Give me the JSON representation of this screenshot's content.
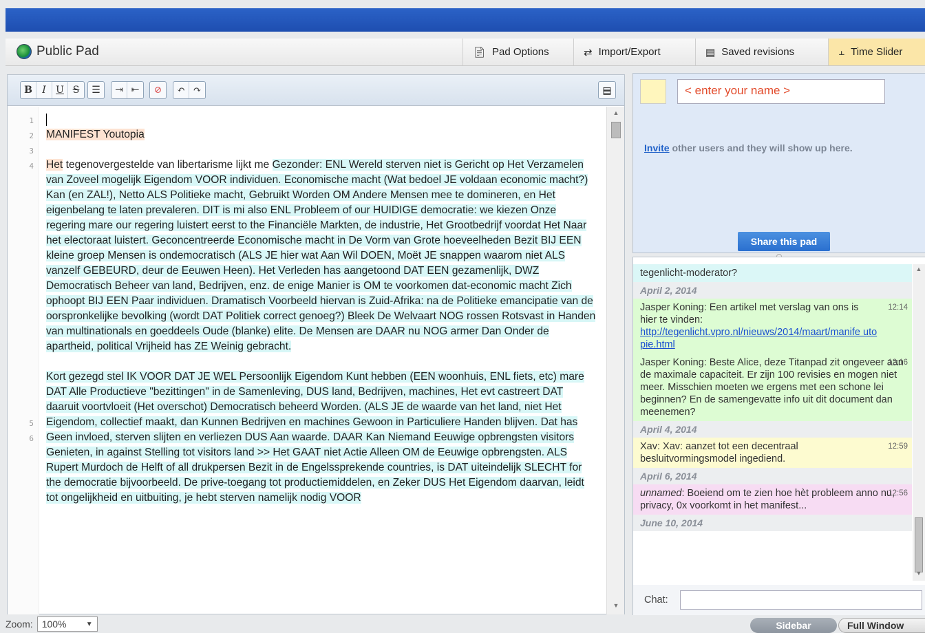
{
  "header": {
    "pad_title": "Public Pad",
    "buttons": {
      "pad_options": "Pad Options",
      "import_export": "Import/Export",
      "saved_revisions": "Saved revisions",
      "time_slider": "Time Slider"
    }
  },
  "toolbar": {
    "bold": "B",
    "italic": "I",
    "underline": "U",
    "strike": "S"
  },
  "editor": {
    "line_numbers": [
      "1",
      "2",
      "3",
      "4",
      "5",
      "6"
    ],
    "line2": [
      "MANIFEST ",
      "Youtopia"
    ],
    "para4_part1": "Het",
    "para4_part2": " tegenovergestelde van libertarisme lijkt me ",
    "para4_part3": "Gezonder: ENL Wereld sterven niet is Gericht op Het Verzamelen van Zoveel mogelijk Eigendom VOOR individuen. Economische macht (Wat bedoel JE voldaan economic macht?) Kan (en ZAL!), Netto ALS Politieke macht, Gebruikt Worden OM Andere Mensen mee te domineren, en Het eigenbelang te laten prevaleren. DIT is mi also ENL Probleem of our HUIDIGE democratie: we kiezen Onze regering mare our regering luistert eerst to the Financiële Markten, de industrie, Het Grootbedrijf voordat Het Naar het electoraat luistert. Geconcentreerde Economische macht in De Vorm van Grote hoeveelheden Bezit BIJ EEN kleine groep Mensen is ondemocratisch (ALS JE hier wat Aan Wil DOEN, Moët JE snappen waarom niet ALS vanzelf GEBEURD, deur de Eeuwen Heen). Het Verleden has aangetoond DAT EEN gezamenlijk, DWZ Democratisch Beheer van land, Bedrijven, enz. de enige Manier is OM te voorkomen dat-economic macht Zich ophoopt BIJ EEN Paar individuen. Dramatisch Voorbeeld hiervan is Zuid-Afrika: na de Politieke emancipatie van de oorspronkelijke bevolking (wordt DAT Politiek correct genoeg?) Bleek De Welvaart NOG rossen Rotsvast in Handen van multinationals en goeddeels Oude (blanke) elite. De Mensen are DAAR nu NOG armer Dan Onder de apartheid, political Vrijheid has ZE Weinig gebracht.",
    "para6": "Kort gezegd stel IK VOOR DAT JE WEL Persoonlijk Eigendom Kunt hebben (EEN woonhuis, ENL fiets, etc) mare DAT Alle Productieve \"bezittingen\" in de Samenleving, DUS land, Bedrijven, machines, Het evt castreert DAT daaruit voortvloeit (Het overschot) Democratisch beheerd Worden. (ALS JE de waarde van het land, niet Het Eigendom, collectief maakt, dan Kunnen Bedrijven en machines Gewoon in Particuliere Handen blijven. Dat has Geen invloed, sterven slijten en verliezen DUS Aan waarde. DAAR Kan Niemand Eeuwige opbrengsten visitors Genieten, in against Stelling tot visitors land >> Het GAAT niet Actie Alleen OM de Eeuwige opbrengsten. ALS Rupert Murdoch de Helft of all drukpersen Bezit in de Engelssprekende countries, is DAT uiteindelijk SLECHT for the democratie bijvoorbeeld. De prive-toegang tot productiemiddelen, en Zeker DUS Het Eigendom daarvan, leidt tot ongelijkheid en uitbuiting, je hebt sterven namelijk nodig VOOR"
  },
  "zoom": {
    "label": "Zoom:",
    "value": "100%"
  },
  "users": {
    "name_placeholder": "< enter your name >",
    "invite_link": "Invite",
    "invite_text": " other users and they will show up here.",
    "share_button": "Share this pad",
    "swatch_color": "#fff6bd"
  },
  "chat": {
    "items": [
      {
        "kind": "msg",
        "color": "cyan",
        "text": "tegenlicht-moderator?",
        "time": ""
      },
      {
        "kind": "date",
        "text": "April 2, 2014"
      },
      {
        "kind": "msg",
        "color": "green",
        "author": "Jasper Koning",
        "text": "Jasper Koning: Een artikel met verslag van ons is hier te vinden:",
        "link": "http://tegenlicht.vpro.nl/nieuws/2014/maart/manife utopie.html",
        "time": "12:14"
      },
      {
        "kind": "msg",
        "color": "green",
        "text": "Jasper Koning: Beste Alice, deze Titanpad zit ongeveer aan de maximale capaciteit. Er zijn 100 revisies en mogen niet meer. Misschien moeten we ergens met een schone lei beginnen? En de samengevatte info uit dit document dan meenemen?",
        "time": "12:16"
      },
      {
        "kind": "date",
        "text": "April 4, 2014"
      },
      {
        "kind": "msg",
        "color": "yellow",
        "text": "Xav: Xav: aanzet tot een decentraal besluitvormingsmodel ingediend.",
        "time": "12:59"
      },
      {
        "kind": "date",
        "text": "April 6, 2014"
      },
      {
        "kind": "msg",
        "color": "pink",
        "author_italic": "unnamed",
        "text": ": Boeiend om te zien hoe hèt probleem anno nu, privacy, 0x voorkomt in het manifest...",
        "time": "12:56"
      },
      {
        "kind": "date",
        "text": "June 10, 2014"
      }
    ],
    "input_label": "Chat:"
  },
  "footer": {
    "sidebar_button": "Sidebar",
    "full_window_button": "Full Window"
  }
}
